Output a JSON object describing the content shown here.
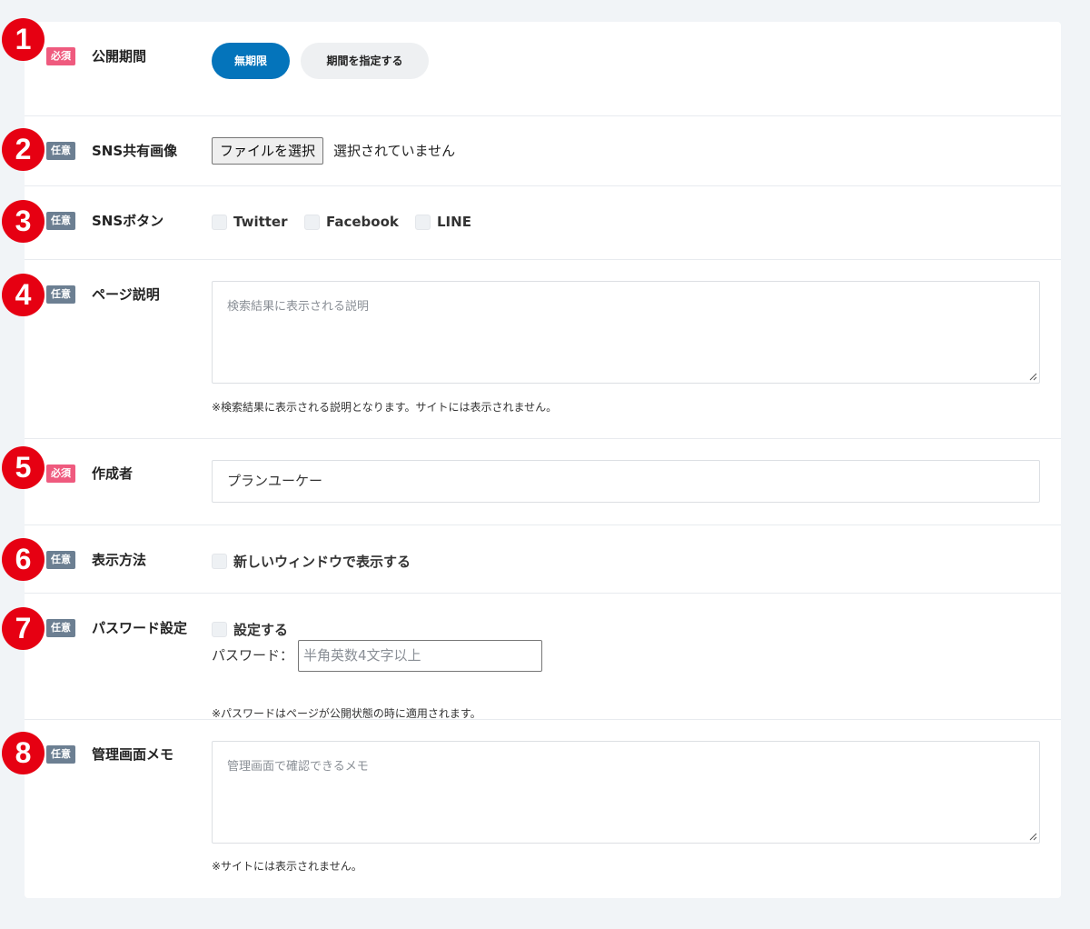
{
  "fields": [
    {
      "number": "1",
      "badge": "必須",
      "label": "公開期間"
    },
    {
      "number": "2",
      "badge": "任意",
      "label": "SNS共有画像"
    },
    {
      "number": "3",
      "badge": "任意",
      "label": "SNSボタン"
    },
    {
      "number": "4",
      "badge": "任意",
      "label": "ページ説明"
    },
    {
      "number": "5",
      "badge": "必須",
      "label": "作成者"
    },
    {
      "number": "6",
      "badge": "任意",
      "label": "表示方法"
    },
    {
      "number": "7",
      "badge": "任意",
      "label": "パスワード設定"
    },
    {
      "number": "8",
      "badge": "任意",
      "label": "管理画面メモ"
    }
  ],
  "period": {
    "unlimited_label": "無期限",
    "specify_label": "期間を指定する",
    "selected": "無期限"
  },
  "sns_image": {
    "button_label": "ファイルを選択",
    "status": "選択されていません"
  },
  "sns_buttons": {
    "options": [
      {
        "label": "Twitter",
        "checked": false
      },
      {
        "label": "Facebook",
        "checked": false
      },
      {
        "label": "LINE",
        "checked": false
      }
    ]
  },
  "description": {
    "placeholder": "検索結果に表示される説明",
    "help": "※検索結果に表示される説明となります。サイトには表示されません。"
  },
  "author": {
    "value": "プランユーケー"
  },
  "display": {
    "option_label": "新しいウィンドウで表示する",
    "checked": false
  },
  "password": {
    "toggle_label": "設定する",
    "checked": false,
    "field_label": "パスワード：",
    "placeholder": "半角英数4文字以上",
    "help": "※パスワードはページが公開状態の時に適用されます。"
  },
  "memo": {
    "placeholder": "管理画面で確認できるメモ",
    "help": "※サイトには表示されません。"
  },
  "colors": {
    "required_badge": "#ef5a7e",
    "optional_badge": "#6c7f92",
    "number_circle": "#e60012",
    "primary_button": "#0474bb"
  }
}
